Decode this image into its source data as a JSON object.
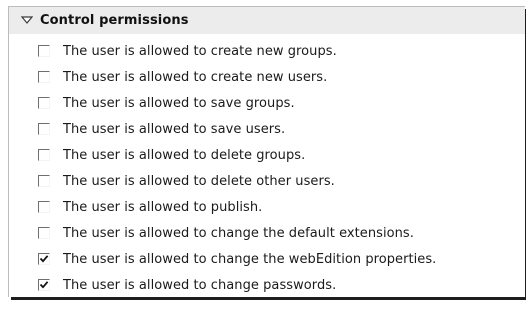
{
  "section": {
    "title": "Control permissions",
    "toggle_icon": "triangle-down-icon"
  },
  "permissions": [
    {
      "label": "The user is allowed to create new groups.",
      "checked": false
    },
    {
      "label": "The user is allowed to create new users.",
      "checked": false
    },
    {
      "label": "The user is allowed to save groups.",
      "checked": false
    },
    {
      "label": "The user is allowed to save users.",
      "checked": false
    },
    {
      "label": "The user is allowed to delete groups.",
      "checked": false
    },
    {
      "label": "The user is allowed to delete other users.",
      "checked": false
    },
    {
      "label": "The user is allowed to publish.",
      "checked": false
    },
    {
      "label": "The user is allowed to change the default extensions.",
      "checked": false
    },
    {
      "label": "The user is allowed to change the webEdition properties.",
      "checked": true
    },
    {
      "label": "The user is allowed to change passwords.",
      "checked": true
    }
  ]
}
